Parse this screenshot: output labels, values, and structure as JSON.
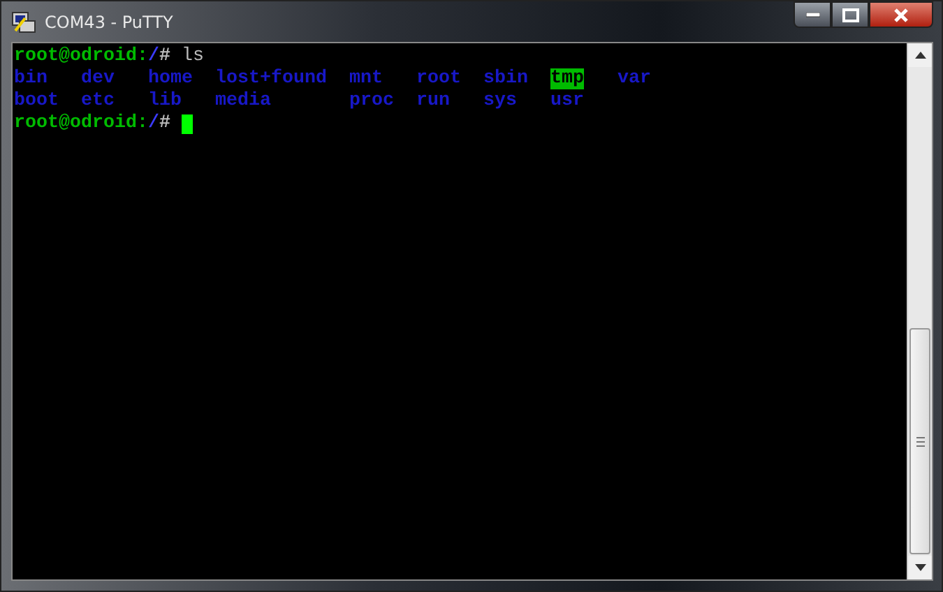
{
  "window": {
    "title": "COM43 - PuTTY"
  },
  "terminal": {
    "prompt_line": {
      "user_host": "root@odroid",
      "separator": ":",
      "path": "/",
      "symbol": "#",
      "command": "ls"
    },
    "listing": [
      [
        {
          "name": "bin",
          "kind": "dir"
        },
        {
          "name": "dev",
          "kind": "dir"
        },
        {
          "name": "home",
          "kind": "dir"
        },
        {
          "name": "lost+found",
          "kind": "dir"
        },
        {
          "name": "mnt",
          "kind": "dir"
        },
        {
          "name": "root",
          "kind": "dir"
        },
        {
          "name": "sbin",
          "kind": "dir"
        },
        {
          "name": "tmp",
          "kind": "sticky"
        },
        {
          "name": "var",
          "kind": "dir"
        }
      ],
      [
        {
          "name": "boot",
          "kind": "dir"
        },
        {
          "name": "etc",
          "kind": "dir"
        },
        {
          "name": "lib",
          "kind": "dir"
        },
        {
          "name": "media",
          "kind": "dir"
        },
        {
          "name": "proc",
          "kind": "dir"
        },
        {
          "name": "run",
          "kind": "dir"
        },
        {
          "name": "sys",
          "kind": "dir"
        },
        {
          "name": "usr",
          "kind": "dir"
        }
      ]
    ],
    "current_prompt": {
      "user_host": "root@odroid",
      "separator": ":",
      "path": "/",
      "symbol": "#"
    }
  }
}
